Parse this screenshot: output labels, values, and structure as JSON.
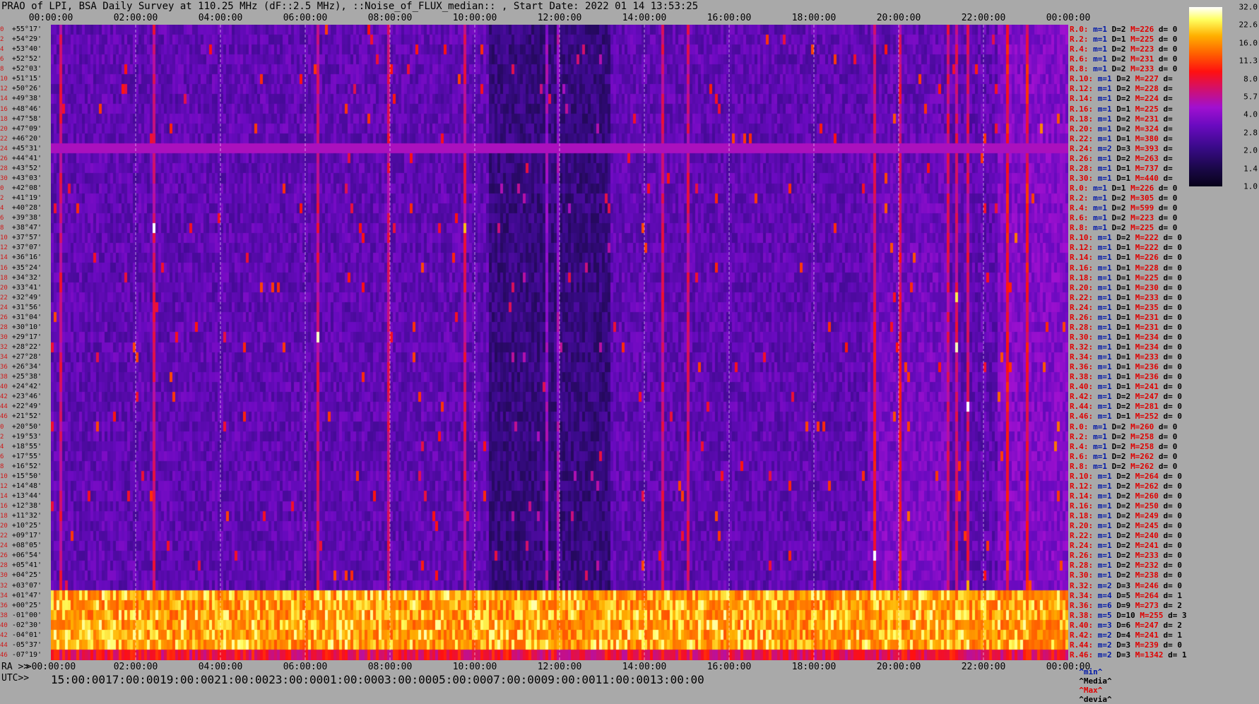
{
  "header": {
    "title": "PRAO of LPI, BSA Daily Survey at 110.25 MHz (dF::2.5 MHz), ::Noise_of_FLUX_median:: , Start Date: 2022 01 14 13:53:25"
  },
  "footer": {
    "ra_prefix": "RA >>",
    "utc_prefix": "UTC>>",
    "legend_min": "^min^",
    "legend_median": "^Media^",
    "legend_max": "^Max^",
    "legend_devia": "^devia^"
  },
  "chart_data": {
    "type": "heatmap",
    "title": "PRAO of LPI, BSA Daily Survey at 110.25 MHz (dF::2.5 MHz), ::Noise_of_FLUX_median:: , Start Date: 2022 01 14 13:53:25",
    "x_ra_ticks": [
      "00:00:00",
      "02:00:00",
      "04:00:00",
      "06:00:00",
      "08:00:00",
      "10:00:00",
      "12:00:00",
      "14:00:00",
      "16:00:00",
      "18:00:00",
      "20:00:00",
      "22:00:00",
      "00:00:00"
    ],
    "x_ra_bottom_ticks": [
      ">00:00:00",
      "02:00:00",
      "04:00:00",
      "06:00:00",
      "08:00:00",
      "10:00:00",
      "12:00:00",
      "14:00:00",
      "16:00:00",
      "18:00:00",
      "20:00:00",
      "22:00:00",
      "00:00:00"
    ],
    "x_utc_ticks": [
      "15:00:00",
      "17:00:00",
      "19:00:00",
      "21:00:00",
      "23:00:00",
      "01:00:00",
      "03:00:00",
      "05:00:00",
      "07:00:00",
      "09:00:00",
      "11:00:00",
      "13:00:00"
    ],
    "colorbar_ticks": [
      "32.0",
      "22.6",
      "16.0",
      "11.3",
      "8.0",
      "5.7",
      "4.0",
      "2.8",
      "2.0",
      "1.4",
      "1.0"
    ],
    "colorscale": "log",
    "bright_rows_declination": [
      "+01°47'",
      "+00°25'",
      "-01°00'",
      "-02°30'",
      "-04°01'",
      "-05°37'",
      "-07°19'"
    ],
    "bright_horizontal_row_declination": "+45°31'",
    "rows": [
      {
        "idx": "0",
        "dec": "+55°17'"
      },
      {
        "idx": "2",
        "dec": "+54°29'"
      },
      {
        "idx": "4",
        "dec": "+53°40'"
      },
      {
        "idx": "6",
        "dec": "+52°52'"
      },
      {
        "idx": "8",
        "dec": "+52°03'"
      },
      {
        "idx": "10",
        "dec": "+51°15'"
      },
      {
        "idx": "12",
        "dec": "+50°26'"
      },
      {
        "idx": "14",
        "dec": "+49°38'"
      },
      {
        "idx": "16",
        "dec": "+48°46'"
      },
      {
        "idx": "18",
        "dec": "+47°58'"
      },
      {
        "idx": "20",
        "dec": "+47°09'"
      },
      {
        "idx": "22",
        "dec": "+46°20'"
      },
      {
        "idx": "24",
        "dec": "+45°31'"
      },
      {
        "idx": "26",
        "dec": "+44°41'"
      },
      {
        "idx": "28",
        "dec": "+43°52'"
      },
      {
        "idx": "30",
        "dec": "+43°03'"
      },
      {
        "idx": "0",
        "dec": "+42°08'"
      },
      {
        "idx": "2",
        "dec": "+41°19'"
      },
      {
        "idx": "4",
        "dec": "+40°28'"
      },
      {
        "idx": "6",
        "dec": "+39°38'"
      },
      {
        "idx": "8",
        "dec": "+38°47'"
      },
      {
        "idx": "10",
        "dec": "+37°57'"
      },
      {
        "idx": "12",
        "dec": "+37°07'"
      },
      {
        "idx": "14",
        "dec": "+36°16'"
      },
      {
        "idx": "16",
        "dec": "+35°24'"
      },
      {
        "idx": "18",
        "dec": "+34°32'"
      },
      {
        "idx": "20",
        "dec": "+33°41'"
      },
      {
        "idx": "22",
        "dec": "+32°49'"
      },
      {
        "idx": "24",
        "dec": "+31°56'"
      },
      {
        "idx": "26",
        "dec": "+31°04'"
      },
      {
        "idx": "28",
        "dec": "+30°10'"
      },
      {
        "idx": "30",
        "dec": "+29°17'"
      },
      {
        "idx": "32",
        "dec": "+28°22'"
      },
      {
        "idx": "34",
        "dec": "+27°28'"
      },
      {
        "idx": "36",
        "dec": "+26°34'"
      },
      {
        "idx": "38",
        "dec": "+25°38'"
      },
      {
        "idx": "40",
        "dec": "+24°42'"
      },
      {
        "idx": "42",
        "dec": "+23°46'"
      },
      {
        "idx": "44",
        "dec": "+22°49'"
      },
      {
        "idx": "46",
        "dec": "+21°52'"
      },
      {
        "idx": "0",
        "dec": "+20°50'"
      },
      {
        "idx": "2",
        "dec": "+19°53'"
      },
      {
        "idx": "4",
        "dec": "+18°55'"
      },
      {
        "idx": "6",
        "dec": "+17°55'"
      },
      {
        "idx": "8",
        "dec": "+16°52'"
      },
      {
        "idx": "10",
        "dec": "+15°50'"
      },
      {
        "idx": "12",
        "dec": "+14°48'"
      },
      {
        "idx": "14",
        "dec": "+13°44'"
      },
      {
        "idx": "16",
        "dec": "+12°38'"
      },
      {
        "idx": "18",
        "dec": "+11°32'"
      },
      {
        "idx": "20",
        "dec": "+10°25'"
      },
      {
        "idx": "22",
        "dec": "+09°17'"
      },
      {
        "idx": "24",
        "dec": "+08°05'"
      },
      {
        "idx": "26",
        "dec": "+06°54'"
      },
      {
        "idx": "28",
        "dec": "+05°41'"
      },
      {
        "idx": "30",
        "dec": "+04°25'"
      },
      {
        "idx": "32",
        "dec": "+03°07'"
      },
      {
        "idx": "34",
        "dec": "+01°47'"
      },
      {
        "idx": "36",
        "dec": "+00°25'"
      },
      {
        "idx": "38",
        "dec": "-01°00'"
      },
      {
        "idx": "40",
        "dec": "-02°30'"
      },
      {
        "idx": "42",
        "dec": "-04°01'"
      },
      {
        "idx": "44",
        "dec": "-05°37'"
      },
      {
        "idx": "46",
        "dec": "-07°19'"
      }
    ],
    "stats": [
      {
        "r": "R.0:",
        "m": "m=1",
        "d": "D=2",
        "M": "M=226",
        "dv": "d= 0"
      },
      {
        "r": "R.2:",
        "m": "m=1",
        "d": "D=1",
        "M": "M=225",
        "dv": "d= 0"
      },
      {
        "r": "R.4:",
        "m": "m=1",
        "d": "D=2",
        "M": "M=223",
        "dv": "d= 0"
      },
      {
        "r": "R.6:",
        "m": "m=1",
        "d": "D=2",
        "M": "M=231",
        "dv": "d= 0"
      },
      {
        "r": "R.8:",
        "m": "m=1",
        "d": "D=2",
        "M": "M=233",
        "dv": "d= 0"
      },
      {
        "r": "R.10:",
        "m": "m=1",
        "d": "D=2",
        "M": "M=227",
        "dv": "d="
      },
      {
        "r": "R.12:",
        "m": "m=1",
        "d": "D=2",
        "M": "M=228",
        "dv": "d="
      },
      {
        "r": "R.14:",
        "m": "m=1",
        "d": "D=2",
        "M": "M=224",
        "dv": "d="
      },
      {
        "r": "R.16:",
        "m": "m=1",
        "d": "D=1",
        "M": "M=225",
        "dv": "d="
      },
      {
        "r": "R.18:",
        "m": "m=1",
        "d": "D=2",
        "M": "M=231",
        "dv": "d="
      },
      {
        "r": "R.20:",
        "m": "m=1",
        "d": "D=2",
        "M": "M=324",
        "dv": "d="
      },
      {
        "r": "R.22:",
        "m": "m=1",
        "d": "D=1",
        "M": "M=380",
        "dv": "d="
      },
      {
        "r": "R.24:",
        "m": "m=2",
        "d": "D=3",
        "M": "M=393",
        "dv": "d="
      },
      {
        "r": "R.26:",
        "m": "m=1",
        "d": "D=2",
        "M": "M=263",
        "dv": "d="
      },
      {
        "r": "R.28:",
        "m": "m=1",
        "d": "D=1",
        "M": "M=737",
        "dv": "d="
      },
      {
        "r": "R.30:",
        "m": "m=1",
        "d": "D=1",
        "M": "M=440",
        "dv": "d="
      },
      {
        "r": "R.0:",
        "m": "m=1",
        "d": "D=1",
        "M": "M=226",
        "dv": "d= 0"
      },
      {
        "r": "R.2:",
        "m": "m=1",
        "d": "D=2",
        "M": "M=305",
        "dv": "d= 0"
      },
      {
        "r": "R.4:",
        "m": "m=1",
        "d": "D=2",
        "M": "M=599",
        "dv": "d= 0"
      },
      {
        "r": "R.6:",
        "m": "m=1",
        "d": "D=2",
        "M": "M=223",
        "dv": "d= 0"
      },
      {
        "r": "R.8:",
        "m": "m=1",
        "d": "D=2",
        "M": "M=225",
        "dv": "d= 0"
      },
      {
        "r": "R.10:",
        "m": "m=1",
        "d": "D=2",
        "M": "M=222",
        "dv": "d= 0"
      },
      {
        "r": "R.12:",
        "m": "m=1",
        "d": "D=1",
        "M": "M=222",
        "dv": "d= 0"
      },
      {
        "r": "R.14:",
        "m": "m=1",
        "d": "D=1",
        "M": "M=226",
        "dv": "d= 0"
      },
      {
        "r": "R.16:",
        "m": "m=1",
        "d": "D=1",
        "M": "M=228",
        "dv": "d= 0"
      },
      {
        "r": "R.18:",
        "m": "m=1",
        "d": "D=1",
        "M": "M=225",
        "dv": "d= 0"
      },
      {
        "r": "R.20:",
        "m": "m=1",
        "d": "D=1",
        "M": "M=230",
        "dv": "d= 0"
      },
      {
        "r": "R.22:",
        "m": "m=1",
        "d": "D=1",
        "M": "M=233",
        "dv": "d= 0"
      },
      {
        "r": "R.24:",
        "m": "m=1",
        "d": "D=1",
        "M": "M=235",
        "dv": "d= 0"
      },
      {
        "r": "R.26:",
        "m": "m=1",
        "d": "D=1",
        "M": "M=231",
        "dv": "d= 0"
      },
      {
        "r": "R.28:",
        "m": "m=1",
        "d": "D=1",
        "M": "M=231",
        "dv": "d= 0"
      },
      {
        "r": "R.30:",
        "m": "m=1",
        "d": "D=1",
        "M": "M=234",
        "dv": "d= 0"
      },
      {
        "r": "R.32:",
        "m": "m=1",
        "d": "D=1",
        "M": "M=234",
        "dv": "d= 0"
      },
      {
        "r": "R.34:",
        "m": "m=1",
        "d": "D=1",
        "M": "M=233",
        "dv": "d= 0"
      },
      {
        "r": "R.36:",
        "m": "m=1",
        "d": "D=1",
        "M": "M=236",
        "dv": "d= 0"
      },
      {
        "r": "R.38:",
        "m": "m=1",
        "d": "D=1",
        "M": "M=236",
        "dv": "d= 0"
      },
      {
        "r": "R.40:",
        "m": "m=1",
        "d": "D=1",
        "M": "M=241",
        "dv": "d= 0"
      },
      {
        "r": "R.42:",
        "m": "m=1",
        "d": "D=2",
        "M": "M=247",
        "dv": "d= 0"
      },
      {
        "r": "R.44:",
        "m": "m=1",
        "d": "D=2",
        "M": "M=281",
        "dv": "d= 0"
      },
      {
        "r": "R.46:",
        "m": "m=1",
        "d": "D=1",
        "M": "M=252",
        "dv": "d= 0"
      },
      {
        "r": "R.0:",
        "m": "m=1",
        "d": "D=2",
        "M": "M=260",
        "dv": "d= 0"
      },
      {
        "r": "R.2:",
        "m": "m=1",
        "d": "D=2",
        "M": "M=258",
        "dv": "d= 0"
      },
      {
        "r": "R.4:",
        "m": "m=1",
        "d": "D=2",
        "M": "M=258",
        "dv": "d= 0"
      },
      {
        "r": "R.6:",
        "m": "m=1",
        "d": "D=2",
        "M": "M=262",
        "dv": "d= 0"
      },
      {
        "r": "R.8:",
        "m": "m=1",
        "d": "D=2",
        "M": "M=262",
        "dv": "d= 0"
      },
      {
        "r": "R.10:",
        "m": "m=1",
        "d": "D=2",
        "M": "M=264",
        "dv": "d= 0"
      },
      {
        "r": "R.12:",
        "m": "m=1",
        "d": "D=2",
        "M": "M=262",
        "dv": "d= 0"
      },
      {
        "r": "R.14:",
        "m": "m=1",
        "d": "D=2",
        "M": "M=260",
        "dv": "d= 0"
      },
      {
        "r": "R.16:",
        "m": "m=1",
        "d": "D=2",
        "M": "M=250",
        "dv": "d= 0"
      },
      {
        "r": "R.18:",
        "m": "m=1",
        "d": "D=2",
        "M": "M=249",
        "dv": "d= 0"
      },
      {
        "r": "R.20:",
        "m": "m=1",
        "d": "D=2",
        "M": "M=245",
        "dv": "d= 0"
      },
      {
        "r": "R.22:",
        "m": "m=1",
        "d": "D=2",
        "M": "M=240",
        "dv": "d= 0"
      },
      {
        "r": "R.24:",
        "m": "m=1",
        "d": "D=2",
        "M": "M=241",
        "dv": "d= 0"
      },
      {
        "r": "R.26:",
        "m": "m=1",
        "d": "D=2",
        "M": "M=233",
        "dv": "d= 0"
      },
      {
        "r": "R.28:",
        "m": "m=1",
        "d": "D=2",
        "M": "M=232",
        "dv": "d= 0"
      },
      {
        "r": "R.30:",
        "m": "m=1",
        "d": "D=2",
        "M": "M=238",
        "dv": "d= 0"
      },
      {
        "r": "R.32:",
        "m": "m=2",
        "d": "D=3",
        "M": "M=246",
        "dv": "d= 0"
      },
      {
        "r": "R.34:",
        "m": "m=4",
        "d": "D=5",
        "M": "M=264",
        "dv": "d= 1"
      },
      {
        "r": "R.36:",
        "m": "m=6",
        "d": "D=9",
        "M": "M=273",
        "dv": "d= 2"
      },
      {
        "r": "R.38:",
        "m": "m=5",
        "d": "D=10",
        "M": "M=255",
        "dv": "d= 3"
      },
      {
        "r": "R.40:",
        "m": "m=3",
        "d": "D=6",
        "M": "M=247",
        "dv": "d= 2"
      },
      {
        "r": "R.42:",
        "m": "m=2",
        "d": "D=4",
        "M": "M=241",
        "dv": "d= 1"
      },
      {
        "r": "R.44:",
        "m": "m=2",
        "d": "D=3",
        "M": "M=239",
        "dv": "d= 0"
      },
      {
        "r": "R.46:",
        "m": "m=2",
        "d": "D=3",
        "M": "M=1342",
        "dv": "d= 1"
      }
    ],
    "colors": {
      "background": "#a9a9a9",
      "low": "#08021a",
      "mid": "#6a0ac0",
      "high": "#ff1010",
      "peak": "#ffffff"
    }
  }
}
